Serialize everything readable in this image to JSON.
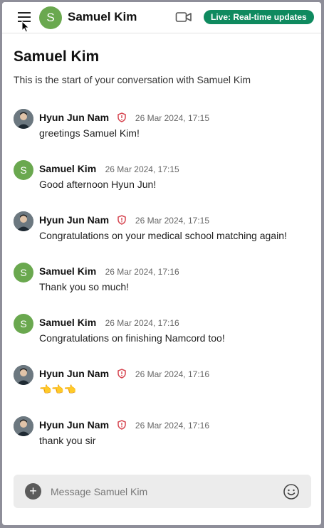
{
  "header": {
    "avatar_initial": "S",
    "title": "Samuel Kim",
    "live_badge": "Live: Real-time updates"
  },
  "intro": {
    "title": "Samuel Kim",
    "subtitle": "This is the start of your conversation with Samuel Kim"
  },
  "messages": [
    {
      "author": "Hyun Jun Nam",
      "time": "26 Mar 2024, 17:15",
      "text": "greetings Samuel Kim!"
    },
    {
      "author": "Samuel Kim",
      "initial": "S",
      "time": "26 Mar 2024, 17:15",
      "text": "Good afternoon Hyun Jun!"
    },
    {
      "author": "Hyun Jun Nam",
      "time": "26 Mar 2024, 17:15",
      "text": "Congratulations on your medical school matching again!"
    },
    {
      "author": "Samuel Kim",
      "initial": "S",
      "time": "26 Mar 2024, 17:16",
      "text": "Thank you so much!"
    },
    {
      "author": "Samuel Kim",
      "initial": "S",
      "time": "26 Mar 2024, 17:16",
      "text": "Congratulations on finishing Namcord too!"
    },
    {
      "author": "Hyun Jun Nam",
      "time": "26 Mar 2024, 17:16",
      "text": "👈👈👈"
    },
    {
      "author": "Hyun Jun Nam",
      "time": "26 Mar 2024, 17:16",
      "text": "thank you sir"
    }
  ],
  "composer": {
    "placeholder": "Message Samuel Kim"
  },
  "colors": {
    "avatar_green": "#6aa84f",
    "live_badge": "#0f8a5f",
    "shield_red": "#d64550"
  }
}
